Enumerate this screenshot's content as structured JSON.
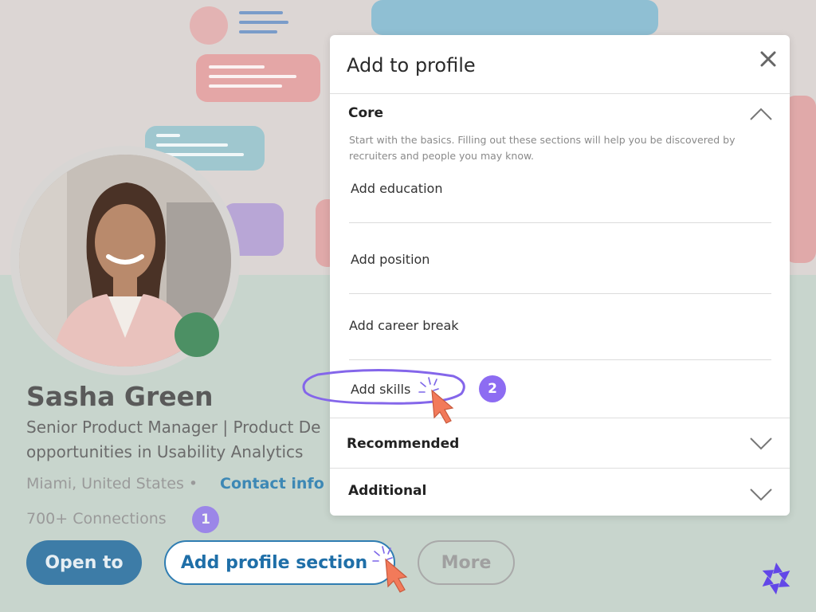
{
  "profile": {
    "name": "Sasha Green",
    "headline_line1": "Senior Product Manager | Product De",
    "headline_line2": "opportunities in Usability Analytics",
    "location": "Miami, United States",
    "location_separator": "•",
    "contact_info": "Contact info",
    "connections": "700+ Connections",
    "status_color": "#4c9064"
  },
  "actions": {
    "open_to": "Open to",
    "add_profile_section": "Add profile section",
    "more": "More"
  },
  "steps": {
    "step1": "1",
    "step2": "2"
  },
  "modal": {
    "title": "Add to profile",
    "core": {
      "title": "Core",
      "description": "Start with the basics. Filling out these sections will help you be discovered by recruiters and people you may know.",
      "items": [
        "Add education",
        "Add position",
        "Add career break",
        "Add skills"
      ]
    },
    "recommended": {
      "title": "Recommended"
    },
    "additional": {
      "title": "Additional"
    }
  },
  "colors": {
    "accent_blue": "#2f7db2",
    "step_purple": "#8d6cf2",
    "cursor_orange": "#f27a5a"
  }
}
